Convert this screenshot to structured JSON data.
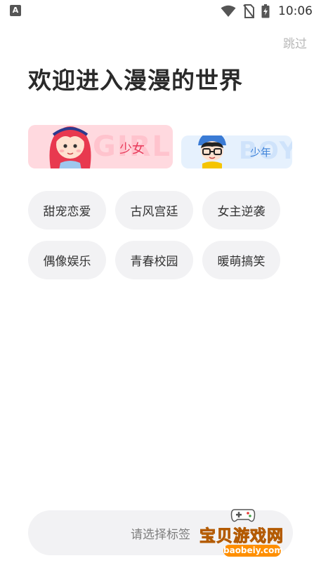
{
  "status_bar": {
    "notification_icon_letter": "A",
    "time": "10:06",
    "icons": [
      "wifi-icon",
      "no-sim-icon",
      "battery-charging-icon"
    ]
  },
  "skip_label": "跳过",
  "title": "欢迎进入漫漫的世界",
  "gender": {
    "girl": {
      "label": "少女",
      "bg_text": "GIRL",
      "color": "#e83a5a"
    },
    "boy": {
      "label": "少年",
      "bg_text": "BOY",
      "color": "#3d82d9"
    }
  },
  "tags": [
    "甜宠恋爱",
    "古风宫廷",
    "女主逆袭",
    "偶像娱乐",
    "青春校园",
    "暖萌搞笑"
  ],
  "confirm_button": "请选择标签",
  "watermark": {
    "name": "宝贝游戏网",
    "url": "baobeiy.com"
  }
}
